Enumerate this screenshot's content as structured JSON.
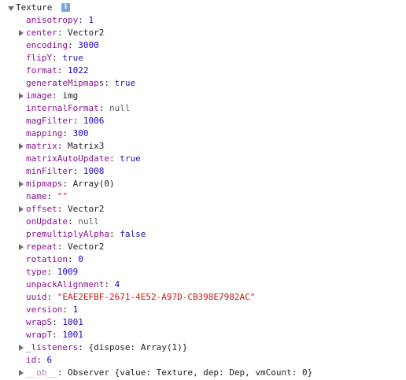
{
  "root": {
    "label": "Texture",
    "info_icon": "i"
  },
  "properties": [
    {
      "key": "anisotropy",
      "value": "1",
      "type": "num",
      "expandable": false
    },
    {
      "key": "center",
      "value": "Vector2",
      "type": "obj",
      "expandable": true
    },
    {
      "key": "encoding",
      "value": "3000",
      "type": "num",
      "expandable": false
    },
    {
      "key": "flipY",
      "value": "true",
      "type": "bool",
      "expandable": false
    },
    {
      "key": "format",
      "value": "1022",
      "type": "num",
      "expandable": false
    },
    {
      "key": "generateMipmaps",
      "value": "true",
      "type": "bool",
      "expandable": false
    },
    {
      "key": "image",
      "value": "img",
      "type": "obj",
      "expandable": true
    },
    {
      "key": "internalFormat",
      "value": "null",
      "type": "null",
      "expandable": false
    },
    {
      "key": "magFilter",
      "value": "1006",
      "type": "num",
      "expandable": false
    },
    {
      "key": "mapping",
      "value": "300",
      "type": "num",
      "expandable": false
    },
    {
      "key": "matrix",
      "value": "Matrix3",
      "type": "obj",
      "expandable": true
    },
    {
      "key": "matrixAutoUpdate",
      "value": "true",
      "type": "bool",
      "expandable": false
    },
    {
      "key": "minFilter",
      "value": "1008",
      "type": "num",
      "expandable": false
    },
    {
      "key": "mipmaps",
      "value": "Array(0)",
      "type": "obj",
      "expandable": true
    },
    {
      "key": "name",
      "value": "\"\"",
      "type": "str",
      "expandable": false
    },
    {
      "key": "offset",
      "value": "Vector2",
      "type": "obj",
      "expandable": true
    },
    {
      "key": "onUpdate",
      "value": "null",
      "type": "null",
      "expandable": false
    },
    {
      "key": "premultiplyAlpha",
      "value": "false",
      "type": "bool",
      "expandable": false
    },
    {
      "key": "repeat",
      "value": "Vector2",
      "type": "obj",
      "expandable": true
    },
    {
      "key": "rotation",
      "value": "0",
      "type": "num",
      "expandable": false
    },
    {
      "key": "type",
      "value": "1009",
      "type": "num",
      "expandable": false
    },
    {
      "key": "unpackAlignment",
      "value": "4",
      "type": "num",
      "expandable": false
    },
    {
      "key": "uuid",
      "value": "\"EAE2EFBF-2671-4E52-A97D-CB398E7982AC\"",
      "type": "str",
      "expandable": false
    },
    {
      "key": "version",
      "value": "1",
      "type": "num",
      "expandable": false
    },
    {
      "key": "wrapS",
      "value": "1001",
      "type": "num",
      "expandable": false
    },
    {
      "key": "wrapT",
      "value": "1001",
      "type": "num",
      "expandable": false
    },
    {
      "key": "_listeners",
      "value": "{dispose: Array(1)}",
      "type": "obj",
      "expandable": true
    },
    {
      "key": "id",
      "value": "6",
      "type": "num",
      "expandable": false
    },
    {
      "key": "__ob__",
      "value": "Observer {value: Texture, dep: Dep, vmCount: 0}",
      "type": "obj",
      "expandable": true,
      "dim": true
    }
  ],
  "colors": {
    "key": "#881391",
    "number": "#1c00cf",
    "boolean": "#1a1aa6",
    "string": "#c41a16",
    "null": "#5e5e5e",
    "info_icon_bg": "#7ea5d8"
  }
}
